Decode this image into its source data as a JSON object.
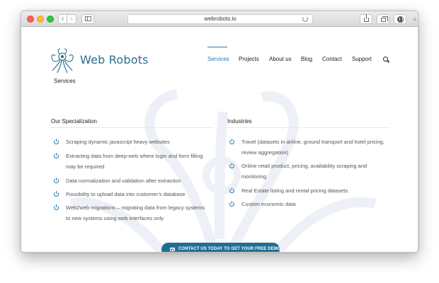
{
  "browser": {
    "url": "webrobots.io",
    "icons": [
      "back-icon",
      "forward-icon",
      "sidebar-icon",
      "reload-icon",
      "share-icon",
      "tabs-icon",
      "downloads-icon",
      "plus-icon"
    ],
    "back_label": "‹",
    "forward_label": "›",
    "new_tab_label": "+"
  },
  "header": {
    "brand": "Web Robots",
    "menu": [
      {
        "label": "Services",
        "active": true
      },
      {
        "label": "Projects",
        "active": false
      },
      {
        "label": "About us",
        "active": false
      },
      {
        "label": "Blog",
        "active": false
      },
      {
        "label": "Contact",
        "active": false
      },
      {
        "label": "Support",
        "active": false
      }
    ]
  },
  "page": {
    "title": "Services"
  },
  "specialization": {
    "heading": "Our Specialization",
    "items": [
      [
        "Scraping dynamic javascript heavy websites"
      ],
      [
        "Extracting data from deep-web where login and form filling",
        "may be required"
      ],
      [
        "Data normalization and validation after extraction"
      ],
      [
        "Possibility to upload data into customer’s database"
      ],
      [
        "Web2web migrations – migrating data from legacy systems",
        "to new systems using web interfaces only"
      ]
    ]
  },
  "industries": {
    "heading": "Industries",
    "items": [
      [
        "Travel (datasets in airline, ground transport and hotel pricing,",
        "review aggregation)"
      ],
      [
        "Online retail product, pricing, availability  scraping and",
        "monitoring"
      ],
      [
        "Real Estate listing and rental pricing datasets"
      ],
      [
        "Custom economic data"
      ]
    ]
  },
  "cta": {
    "label": "CONTACT US TODAY TO GET YOUR FREE DEMO"
  },
  "colors": {
    "accent": "#1e7db0",
    "brand": "#2a6f8f",
    "cta_background": "#1f6f93"
  }
}
